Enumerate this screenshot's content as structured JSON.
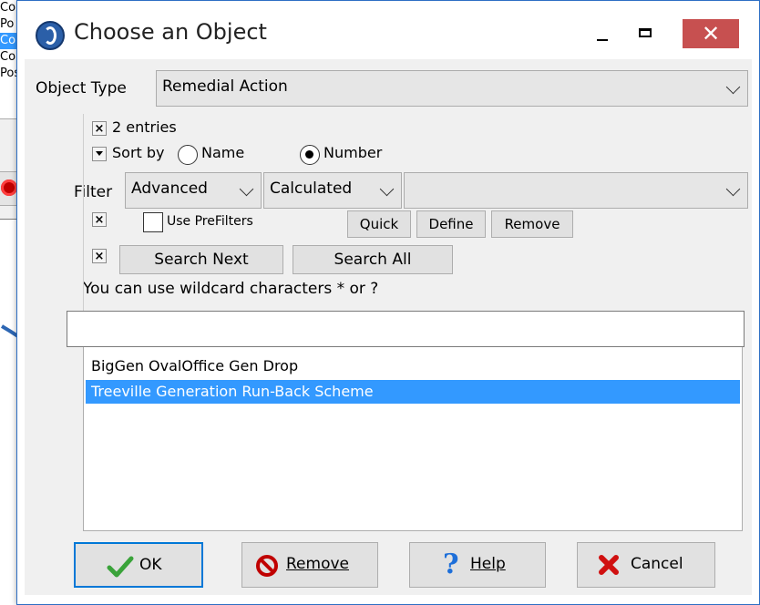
{
  "background_window": {
    "list_items": [
      "Condition",
      "Po",
      "Cor",
      "Cor",
      "Posi"
    ],
    "selected_index": 2
  },
  "dialog": {
    "title": "Choose an Object",
    "close_glyph": "✕",
    "object_type": {
      "label": "Object Type",
      "value": "Remedial Action"
    },
    "entries": {
      "collapse_glyph": "×",
      "count_text": "2 entries"
    },
    "sort": {
      "label": "Sort by",
      "options": [
        "Name",
        "Number"
      ],
      "selected": "Number"
    },
    "filter": {
      "label": "Filter",
      "mode": "Advanced",
      "field": "Calculated",
      "value": ""
    },
    "prefilters": {
      "collapse_glyph": "×",
      "checkbox_label": "Use PreFilters",
      "checked": false,
      "quick_label": "Quick",
      "define_label": "Define",
      "remove_label": "Remove"
    },
    "search": {
      "collapse_glyph": "×",
      "search_next_label": "Search Next",
      "search_all_label": "Search All",
      "hint": "You can use wildcard characters * or ?",
      "input_value": ""
    },
    "results": {
      "items": [
        "BigGen OvalOffice Gen Drop",
        "Treeville Generation Run-Back Scheme"
      ],
      "selected_index": 1
    },
    "buttons": {
      "ok": "OK",
      "remove": "Remove",
      "help": "Help",
      "cancel": "Cancel"
    },
    "colors": {
      "selection": "#3399ff",
      "close_button": "#c75050",
      "default_button_border": "#0078d7",
      "ok_check": "#3aa33a",
      "remove_icon": "#c00000",
      "help_icon": "#1e6fd9",
      "cancel_icon": "#d01010",
      "annotation_arrow": "#2d66b3"
    }
  }
}
